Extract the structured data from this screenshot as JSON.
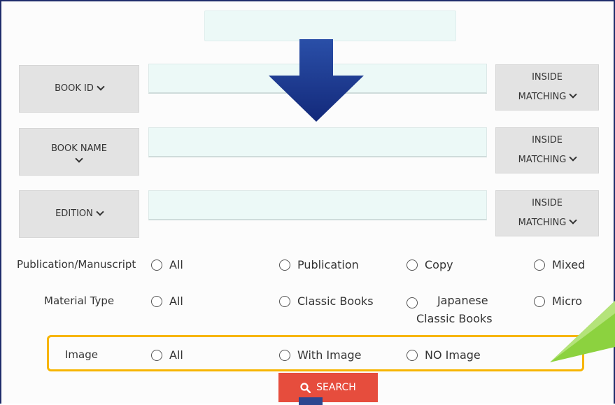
{
  "fields": [
    {
      "label": "BOOK ID",
      "match_line1": "INSIDE",
      "match_line2": "MATCHING"
    },
    {
      "label_line1": "BOOK NAME",
      "match_line1": "INSIDE",
      "match_line2": "MATCHING"
    },
    {
      "label": "EDITION",
      "match_line1": "INSIDE",
      "match_line2": "MATCHING"
    }
  ],
  "publication_row": {
    "label": "Publication/Manuscript",
    "options": [
      "All",
      "Publication",
      "Copy",
      "Mixed"
    ]
  },
  "material_row": {
    "label": "Material Type",
    "options": [
      "All",
      "Classic Books",
      "Japanese",
      "Classic Books",
      "Micro"
    ]
  },
  "image_row": {
    "label": "Image",
    "options": [
      "All",
      "With Image",
      "NO Image"
    ]
  },
  "search_label": "SEARCH",
  "colors": {
    "arrow": "#1c3a8a",
    "highlight": "#f7b500",
    "callout": "#8cd23f",
    "search": "#e64d3d"
  }
}
